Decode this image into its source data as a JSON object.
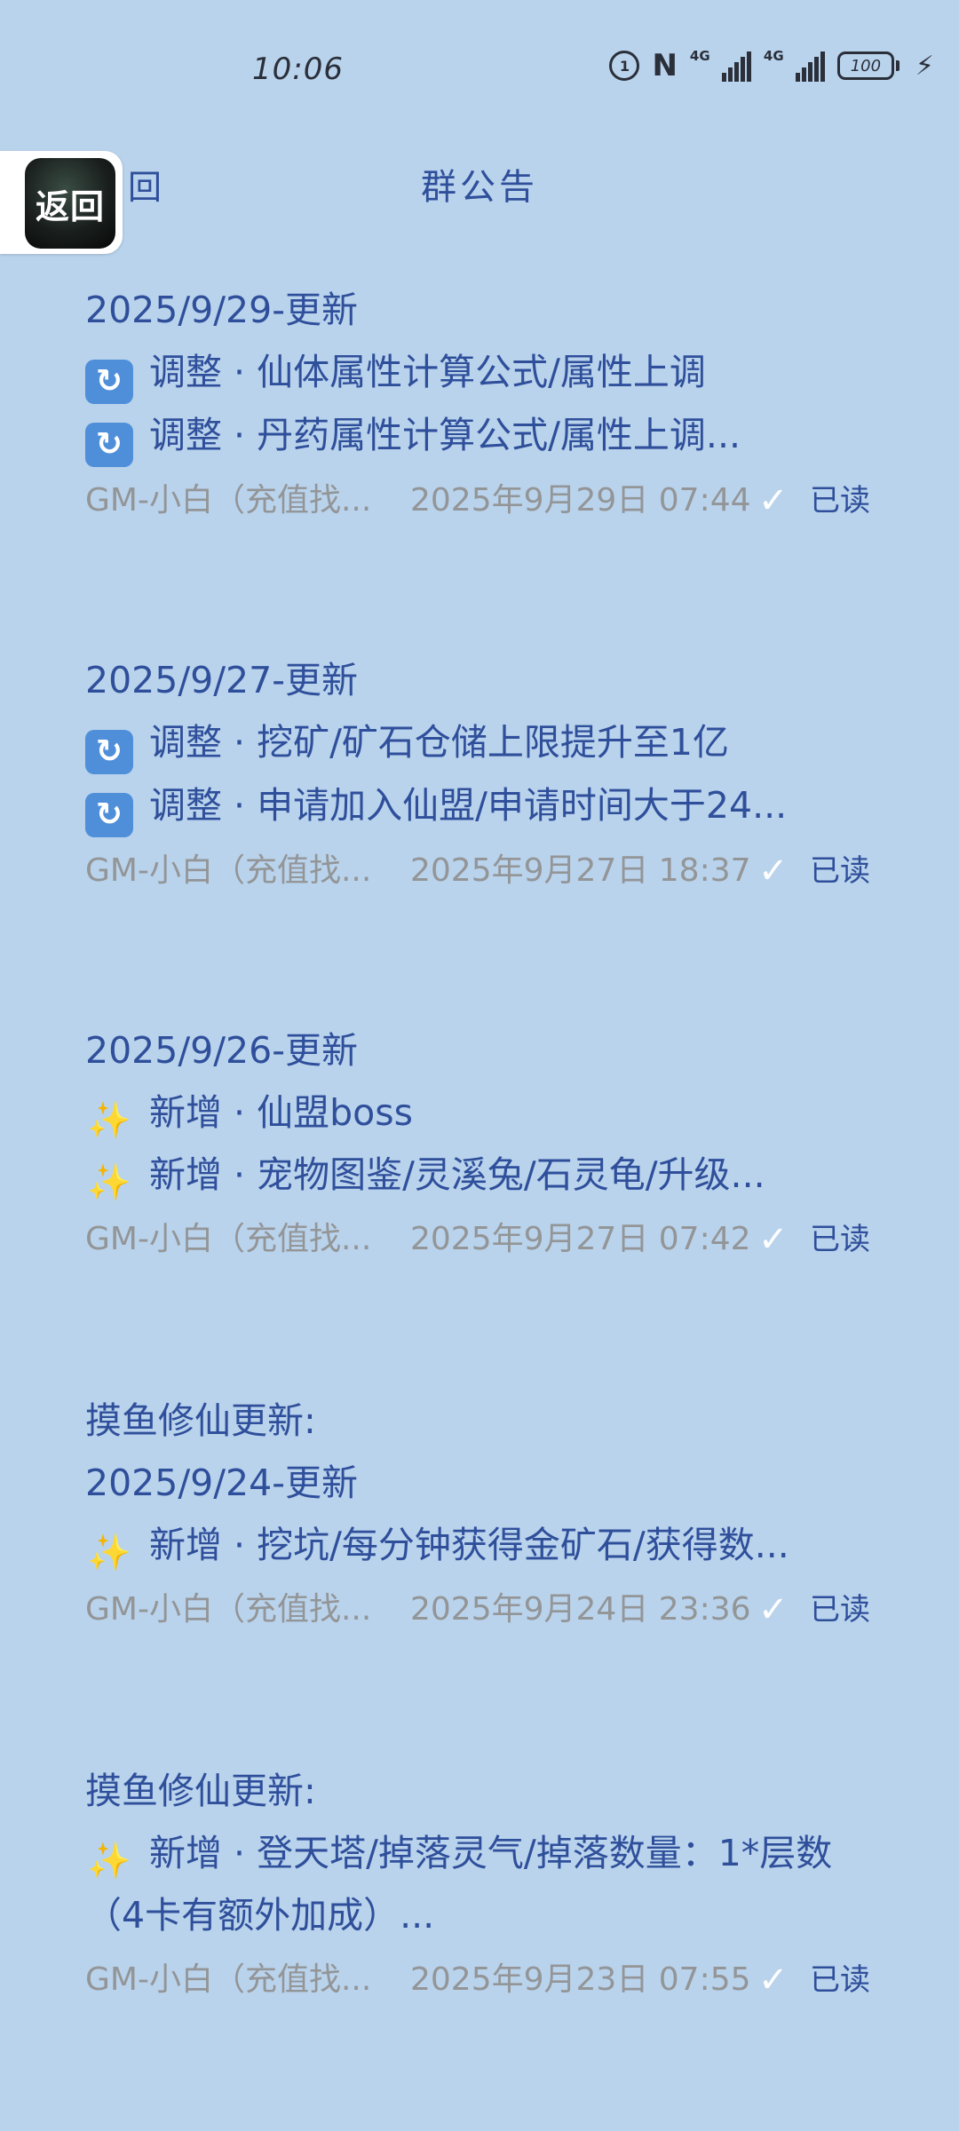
{
  "status_bar": {
    "time": "10:06",
    "hd": "1",
    "nfc": "N",
    "net1": "4G",
    "net2": "4G",
    "battery": "100"
  },
  "header": {
    "back_label": "返回",
    "back_text_fragment": "回",
    "title": "群公告"
  },
  "notices": [
    {
      "lines": [
        "2025/9/29-更新",
        "调整 · 仙体属性计算公式/属性上调",
        "调整 · 丹药属性计算公式/属性上调..."
      ],
      "author": "GM-小白（充值找...",
      "time": "2025年9月29日 07:44",
      "read": "已读"
    },
    {
      "lines": [
        "2025/9/27-更新",
        "调整 · 挖矿/矿石仓储上限提升至1亿",
        "调整 · 申请加入仙盟/申请时间大于24..."
      ],
      "author": "GM-小白（充值找...",
      "time": "2025年9月27日 18:37",
      "read": "已读"
    },
    {
      "lines": [
        "2025/9/26-更新",
        "新增 · 仙盟boss",
        "新增 · 宠物图鉴/灵溪兔/石灵龟/升级..."
      ],
      "author": "GM-小白（充值找...",
      "time": "2025年9月27日 07:42",
      "read": "已读"
    },
    {
      "lines": [
        "摸鱼修仙更新:",
        "2025/9/24-更新",
        "新增 · 挖坑/每分钟获得金矿石/获得数..."
      ],
      "author": "GM-小白（充值找...",
      "time": "2025年9月24日 23:36",
      "read": "已读"
    },
    {
      "lines": [
        "摸鱼修仙更新:",
        "新增 · 登天塔/掉落灵气/掉落数量：1*层数（4卡有额外加成）..."
      ],
      "author": "GM-小白（充值找...",
      "time": "2025年9月23日 07:55",
      "read": "已读"
    }
  ],
  "icons": {
    "refresh": "arrows-counterclockwise-emoji",
    "sparkles": "sparkles-emoji",
    "check": "check-icon"
  }
}
